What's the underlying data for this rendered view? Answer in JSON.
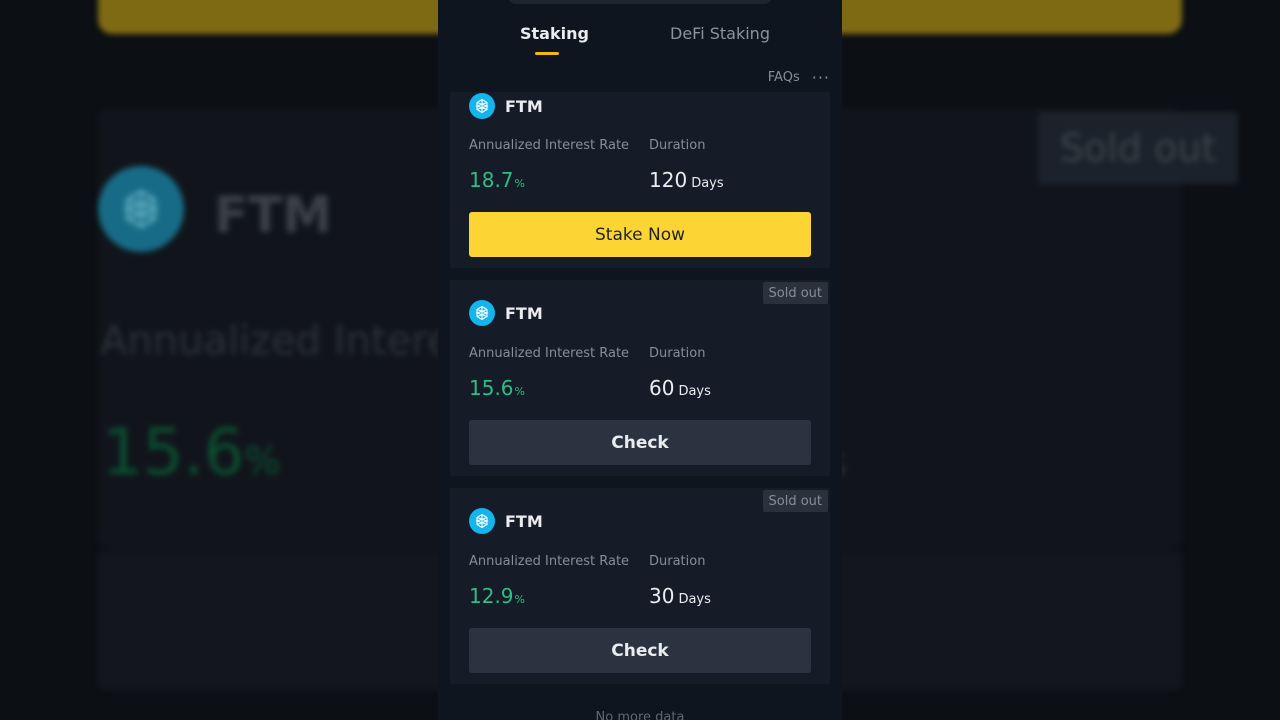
{
  "tabs": [
    {
      "label": "Staking",
      "active": true
    },
    {
      "label": "DeFi Staking",
      "active": false
    }
  ],
  "header": {
    "faq_label": "FAQs",
    "more_icon": "more-icon"
  },
  "labels": {
    "rate": "Annualized Interest Rate",
    "duration": "Duration"
  },
  "products": [
    {
      "coin": "FTM",
      "rate": "18.7",
      "rate_unit": "%",
      "duration": "120",
      "duration_unit": "Days",
      "button": "Stake Now",
      "badge": ""
    },
    {
      "coin": "FTM",
      "rate": "15.6",
      "rate_unit": "%",
      "duration": "60",
      "duration_unit": "Days",
      "button": "Check",
      "badge": "Sold out"
    },
    {
      "coin": "FTM",
      "rate": "12.9",
      "rate_unit": "%",
      "duration": "30",
      "duration_unit": "Days",
      "button": "Check",
      "badge": "Sold out"
    }
  ],
  "footer": {
    "no_more": "No more data"
  },
  "background": {
    "coin": "FTM",
    "label": "Annualized Intere",
    "rate": "15.6",
    "rate_unit": "%",
    "trailing": "s",
    "badge": "Sold out"
  },
  "colors": {
    "accent": "#fcd535",
    "positive": "#2ebd85",
    "coin": "#13b5ec"
  }
}
